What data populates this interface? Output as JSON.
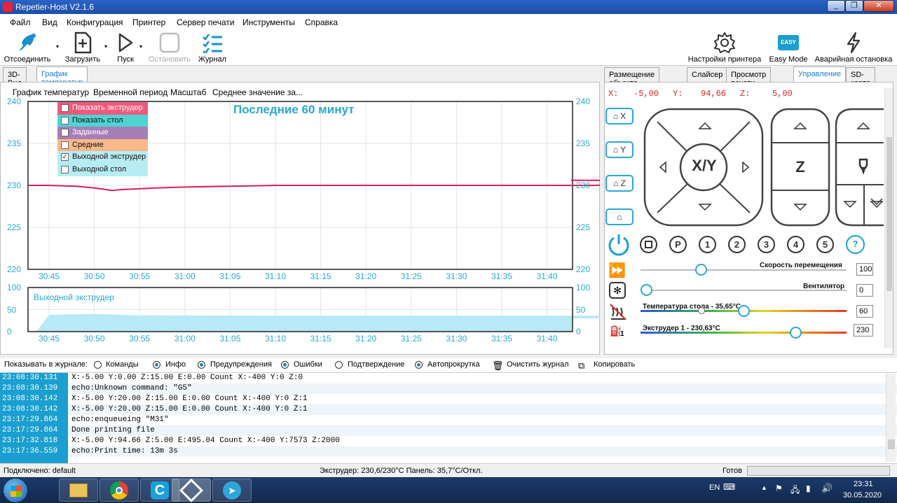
{
  "window": {
    "title": "Repetier-Host V2.1.6",
    "min": "_",
    "max": "❐",
    "close": "✕"
  },
  "menu": [
    "Файл",
    "Вид",
    "Конфигурация",
    "Принтер",
    "Сервер печати",
    "Инструменты",
    "Справка"
  ],
  "toolbar": {
    "disconnect": "Отсоединить",
    "load": "Загрузить",
    "start": "Пуск",
    "stop": "Остановить",
    "log": "Журнал",
    "printer_settings": "Настройки принтера",
    "easy_mode": "Easy Mode",
    "easy_badge": "EASY",
    "emergency": "Аварийная остановка"
  },
  "left_tabs": [
    "3D-Вид",
    "График температур"
  ],
  "right_tabs": [
    "Размещение объекта",
    "Слайсер",
    "Просмотр печати",
    "Управление",
    "SD-карта"
  ],
  "chart_menu": [
    "График температур",
    "Временной период",
    "Масштаб",
    "Среднее значение за..."
  ],
  "legend": [
    {
      "label": "Показать экструдер",
      "checked": true,
      "color": "#ef5a7c",
      "text_color": "#ffffff"
    },
    {
      "label": "Показать стол",
      "checked": false,
      "color": "#4fd3d3",
      "text_color": "#111111"
    },
    {
      "label": "Заданные",
      "checked": false,
      "color": "#a77fb6",
      "text_color": "#ffffff"
    },
    {
      "label": "Средние",
      "checked": false,
      "color": "#f9b98a",
      "text_color": "#111111"
    },
    {
      "label": "Выходной экструдер",
      "checked": true,
      "color": "#b7ecf5",
      "text_color": "#111111"
    },
    {
      "label": "Выходной стол",
      "checked": false,
      "color": "#b7ecf5",
      "text_color": "#111111"
    }
  ],
  "chart_data": [
    {
      "type": "line",
      "title": "Последние 60 минут",
      "x_ticks": [
        "30:45",
        "30:50",
        "30:55",
        "31:00",
        "31:05",
        "31:10",
        "31:15",
        "31:20",
        "31:25",
        "31:30",
        "31:35",
        "31:40"
      ],
      "ylim": [
        220,
        240
      ],
      "y_ticks": [
        220,
        225,
        230,
        235,
        240
      ],
      "grid": true,
      "series": [
        {
          "color": "#d81e5b",
          "x_minutes": [
            30.75,
            30.78,
            30.8,
            30.82,
            30.83,
            30.87,
            30.9,
            30.95,
            31.0,
            31.2,
            31.3,
            31.35,
            31.4,
            31.45,
            31.5,
            31.55,
            31.6,
            31.63,
            31.66,
            31.7,
            31.72
          ],
          "values": [
            230.0,
            229.9,
            229.7,
            229.4,
            229.5,
            229.7,
            229.8,
            229.9,
            230.0,
            230.0,
            230.0,
            230.0,
            230.1,
            230.0,
            229.9,
            230.0,
            230.1,
            230.3,
            230.5,
            230.6,
            230.6
          ]
        }
      ]
    },
    {
      "type": "area",
      "title": "Выходной экструдер",
      "x_ticks": [
        "30:45",
        "30:50",
        "30:55",
        "31:00",
        "31:05",
        "31:10",
        "31:15",
        "31:20",
        "31:25",
        "31:30",
        "31:35",
        "31:40"
      ],
      "ylim": [
        0,
        100
      ],
      "y_ticks": [
        0,
        50,
        100
      ],
      "series": [
        {
          "color": "#b7e9f6",
          "x_minutes": [
            30.75,
            30.8,
            30.85,
            31.0,
            31.2,
            31.4,
            31.5,
            31.55,
            31.6,
            31.65,
            31.7,
            31.72
          ],
          "values": [
            38,
            40,
            37,
            36,
            36,
            36,
            35,
            34,
            35,
            28,
            27,
            30
          ]
        }
      ]
    }
  ],
  "control": {
    "x_label": "X:",
    "x_val": "-5,00",
    "y_label": "Y:",
    "y_val": "94,66",
    "z_label": "Z:",
    "z_val": "5,00",
    "home_x": "X",
    "home_y": "Y",
    "home_z": "Z",
    "xy": "X/Y",
    "z": "Z",
    "circles": [
      "P",
      "1",
      "2",
      "3",
      "4",
      "5",
      "?"
    ],
    "speed_label": "Скорость перемещения",
    "speed_val": "100",
    "speed_level": 0.28,
    "fan_label": "Вентилятор",
    "fan_val": "0",
    "fan_level": 0.0,
    "bed_label": "Температура стола - 35,65°С",
    "bed_val": "60",
    "bed_level": 0.5,
    "ext_label": "Экструдер 1 - 230,63°С",
    "ext_val": "230",
    "ext_level": 0.77,
    "ext_index": "1"
  },
  "logbar": {
    "show": "Показывать в журнале:",
    "opts": [
      {
        "label": "Команды",
        "on": false
      },
      {
        "label": "Инфо",
        "on": true
      },
      {
        "label": "Предупреждения",
        "on": true
      },
      {
        "label": "Ошибки",
        "on": true
      },
      {
        "label": "Подтверждение",
        "on": false
      },
      {
        "label": "Автопрокрутка",
        "on": true
      }
    ],
    "clear": "Очистить журнал",
    "copy": "Копировать"
  },
  "log": [
    {
      "t": "23:08:30.131",
      "m": "X:-5.00 Y:0.00 Z:15.00 E:0.00 Count X:-400 Y:0 Z:0"
    },
    {
      "t": "23:08:30.139",
      "m": "echo:Unknown command: \"G5\""
    },
    {
      "t": "23:08:30.142",
      "m": "X:-5.00 Y:20.00 Z:15.00 E:0.00 Count X:-400 Y:0 Z:1"
    },
    {
      "t": "23:08:30.142",
      "m": "X:-5.00 Y:20.00 Z:15.00 E:0.00 Count X:-400 Y:0 Z:1"
    },
    {
      "t": "23:17:29.864",
      "m": "echo:enqueueing \"M31\""
    },
    {
      "t": "23:17:29.864",
      "m": "Done printing file"
    },
    {
      "t": "23:17:32.818",
      "m": "X:-5.00 Y:94.66 Z:5.00 E:495.04 Count X:-400 Y:7573 Z:2000"
    },
    {
      "t": "23:17:36.559",
      "m": "echo:Print time: 13m 3s"
    }
  ],
  "status": {
    "connected": "Подключено: default",
    "temps": "Экструдер: 230,6/230°С Панель: 35,7°С/Откл.",
    "ready": "Готов"
  },
  "taskbar": {
    "lang": "EN",
    "time": "23:31",
    "date": "30.05.2020"
  }
}
